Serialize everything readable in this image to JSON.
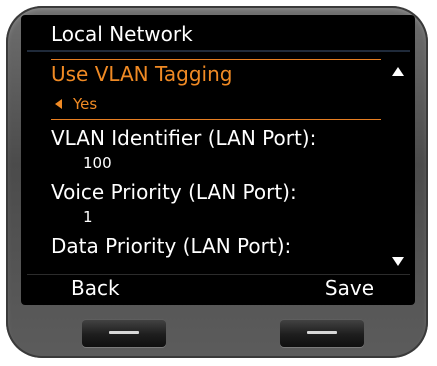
{
  "header": {
    "title": "Local Network"
  },
  "list": {
    "vlan_tagging": {
      "label": "Use VLAN Tagging",
      "value": "Yes"
    },
    "vlan_id": {
      "label": "VLAN Identifier (LAN Port):",
      "value": "100"
    },
    "voice_priority": {
      "label": "Voice Priority (LAN Port):",
      "value": "1"
    },
    "data_priority": {
      "label": "Data Priority (LAN Port):"
    }
  },
  "softkeys": {
    "left": "Back",
    "right": "Save"
  },
  "colors": {
    "accent": "#f08a24",
    "background": "#000000",
    "text": "#ffffff"
  },
  "icons": {
    "scroll_up": "triangle-up",
    "scroll_down": "triangle-down",
    "left": "triangle-left"
  }
}
